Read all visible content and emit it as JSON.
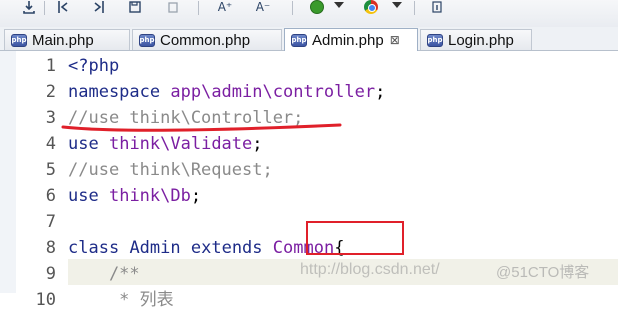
{
  "toolbar": {
    "buttons": [
      "export-icon",
      "first-icon",
      "last-icon",
      "save-icon",
      "copy-icon",
      "font-increase",
      "font-decrease",
      "run-icon",
      "browser-icon",
      "info-icon"
    ],
    "font_increase": "A⁺",
    "font_decrease": "A⁻"
  },
  "tabs": [
    {
      "label": "Main.php",
      "active": false
    },
    {
      "label": "Common.php",
      "active": false
    },
    {
      "label": "Admin.php",
      "active": true,
      "close": "⊠"
    },
    {
      "label": "Login.php",
      "active": false
    }
  ],
  "php_badge": "php",
  "code_lines": [
    {
      "n": "1",
      "text": "<?php"
    },
    {
      "n": "2",
      "text": "namespace app\\admin\\controller;"
    },
    {
      "n": "3",
      "text": "//use think\\Controller;"
    },
    {
      "n": "4",
      "text": "use think\\Validate;"
    },
    {
      "n": "5",
      "text": "//use think\\Request;"
    },
    {
      "n": "6",
      "text": "use think\\Db;"
    },
    {
      "n": "7",
      "text": ""
    },
    {
      "n": "8",
      "text": "class Admin extends Common{"
    },
    {
      "n": "9",
      "text": "    /**"
    },
    {
      "n": "10",
      "text": "     * 列表"
    }
  ],
  "tokens": {
    "line1": "<?php",
    "line2_kw": "namespace",
    "line2_id": "app\\admin\\controller",
    "line2_end": ";",
    "line3": "//use think\\Controller;",
    "line4_kw": "use",
    "line4_id": "think\\Validate",
    "line4_end": ";",
    "line5": "//use think\\Request;",
    "line6_kw": "use",
    "line6_id": "think\\Db",
    "line6_end": ";",
    "line8_kw1": "class",
    "line8_name": "Admin",
    "line8_kw2": "extends",
    "line8_parent": "Common",
    "line8_brace": "{",
    "line9": "    /**",
    "line10": "     * 列表"
  },
  "watermark": "http://blog.csdn.net/",
  "watermark2": "@51CTO博客",
  "colors": {
    "keyword": "#1e2c88",
    "identifier": "#7b1fa2",
    "comment": "#8a8a8a",
    "annotation": "#e0202a"
  }
}
